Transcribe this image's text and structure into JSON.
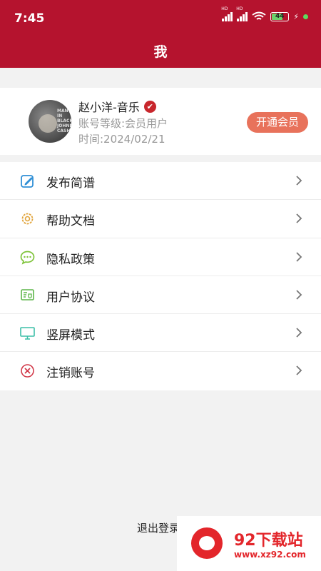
{
  "status_bar": {
    "time": "7:45",
    "battery": "44",
    "hd1": "HD",
    "hd2": "HD"
  },
  "header": {
    "title": "我"
  },
  "profile": {
    "name": "赵小洋-音乐",
    "level": "账号等级:会员用户",
    "date": "时间:2024/02/21",
    "vip_button": "开通会员",
    "avatar_text": "MAN IN BLACK JOHNNY CASH"
  },
  "menu": {
    "items": [
      {
        "label": "发布简谱",
        "icon": "edit-icon",
        "color": "#2f8fd6"
      },
      {
        "label": "帮助文档",
        "icon": "gear-icon",
        "color": "#e1a43b"
      },
      {
        "label": "隐私政策",
        "icon": "chat-icon",
        "color": "#7ec339"
      },
      {
        "label": "用户协议",
        "icon": "agreement-icon",
        "color": "#5db54a"
      },
      {
        "label": "竖屏模式",
        "icon": "monitor-icon",
        "color": "#3dbfa8"
      },
      {
        "label": "注销账号",
        "icon": "cancel-icon",
        "color": "#d23a4a"
      }
    ]
  },
  "footer": {
    "logout": "退出登录"
  },
  "watermark": {
    "title": "92下载站",
    "url": "www.xz92.com"
  },
  "colors": {
    "brand": "#b5132e",
    "vip": "#e8725b"
  }
}
